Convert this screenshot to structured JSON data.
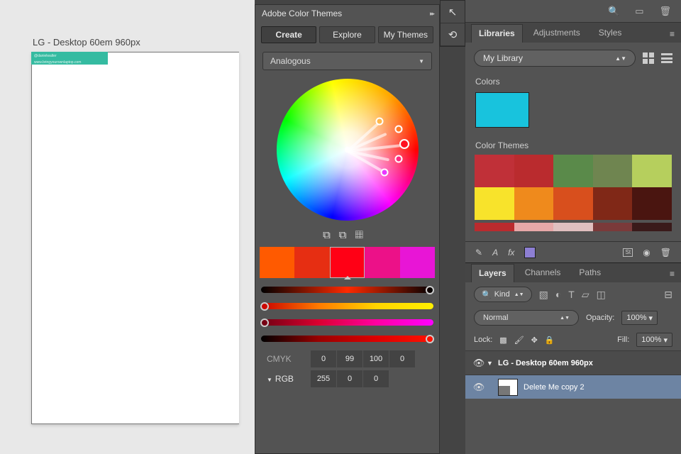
{
  "artboard": {
    "title": "LG - Desktop 60em 960px",
    "banner1": "@danielwalter",
    "banner2": "www.bringyourownlaptop.com"
  },
  "colorThemes": {
    "panelTitle": "Adobe Color Themes",
    "tabs": {
      "create": "Create",
      "explore": "Explore",
      "myThemes": "My Themes"
    },
    "harmony": "Analogous",
    "swatches": [
      "#ff5a00",
      "#e62e12",
      "#ff0015",
      "#ec1188",
      "#e815d6"
    ],
    "modes": {
      "cmyk": {
        "label": "CMYK",
        "vals": [
          "0",
          "99",
          "100",
          "0"
        ]
      },
      "rgb": {
        "label": "RGB",
        "vals": [
          "255",
          "0",
          "0"
        ]
      }
    }
  },
  "libraries": {
    "tabs": {
      "lib": "Libraries",
      "adj": "Adjustments",
      "sty": "Styles"
    },
    "selector": "My Library",
    "colorsLabel": "Colors",
    "colorSwatch": "#18c3dd",
    "themesLabel": "Color Themes",
    "themeGrid": [
      "#c03038",
      "#ba2b2e",
      "#5a8a4a",
      "#6f8550",
      "#b6cf5d",
      "#f8e32b",
      "#ef8a1c",
      "#d84f1d",
      "#802817",
      "#4a1510"
    ],
    "themeGrid2": [
      "#ba2b2e",
      "#e7a8a8",
      "#e0bfbf",
      "#7a3a3a",
      "#3a1a1a"
    ]
  },
  "layers": {
    "tabs": {
      "layers": "Layers",
      "channels": "Channels",
      "paths": "Paths"
    },
    "kind": "Kind",
    "blend": "Normal",
    "opacityLabel": "Opacity:",
    "opacity": "100%",
    "lockLabel": "Lock:",
    "fillLabel": "Fill:",
    "fill": "100%",
    "group": "LG - Desktop 60em 960px",
    "layerSel": "Delete Me copy 2"
  }
}
